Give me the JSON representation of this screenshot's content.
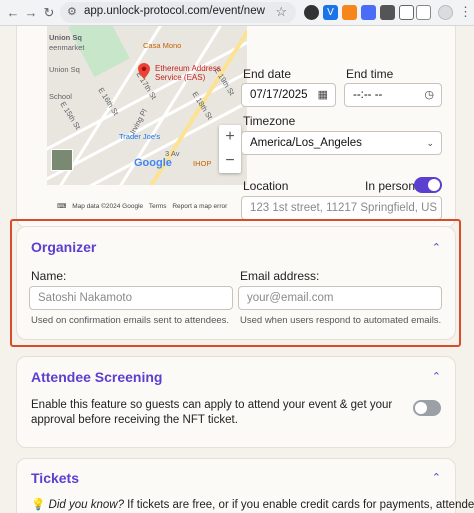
{
  "browser": {
    "url": "app.unlock-protocol.com/event/new",
    "back_icon": "←",
    "forward_icon": "→",
    "reload_icon": "↻"
  },
  "map": {
    "labels": {
      "union_sq_top": "Union Sq",
      "greenmarket": "eenmarket",
      "union_sq_mid": "Union Sq",
      "school": "School",
      "casa_mono": "Casa Mono",
      "trader_joes": "Trader Joe's",
      "irving_pl": "Irving Pl",
      "e15": "E 15th St",
      "e16": "E 16th St",
      "e17": "E 17th St",
      "e18": "E 18th St",
      "e19": "E 19th St",
      "av3": "3 Av",
      "ihop": "IHOP"
    },
    "pin_label": "Ethereum Address Service (EAS)",
    "google_logo": "Google",
    "footer": {
      "map_data": "Map data ©2024 Google",
      "terms": "Terms",
      "report": "Report a map error"
    }
  },
  "event_form": {
    "end_date_label": "End date",
    "end_date_value": "07/17/2025",
    "end_time_label": "End time",
    "end_time_value": "--:-- --",
    "timezone_label": "Timezone",
    "timezone_value": "America/Los_Angeles",
    "location_label": "Location",
    "in_person_label": "In person",
    "in_person_on": true,
    "location_placeholder": "123 1st street, 11217 Springfield, US"
  },
  "organizer": {
    "title": "Organizer",
    "name_label": "Name:",
    "name_placeholder": "Satoshi Nakamoto",
    "name_help": "Used on confirmation emails sent to attendees.",
    "email_label": "Email address:",
    "email_placeholder": "your@email.com",
    "email_help": "Used when users respond to automated emails."
  },
  "attendee_screening": {
    "title": "Attendee Screening",
    "description": "Enable this feature so guests can apply to attend your event & get your approval before receiving the NFT ticket.",
    "enabled": false
  },
  "tickets": {
    "title": "Tickets",
    "did_you_know": "Did you know?",
    "text": " If tickets are free, or if you enable credit cards for payments, attendees do"
  },
  "colors": {
    "accent": "#5b3fcf",
    "highlight": "#d94b2b",
    "toggle_off": "#9aa0a6"
  }
}
